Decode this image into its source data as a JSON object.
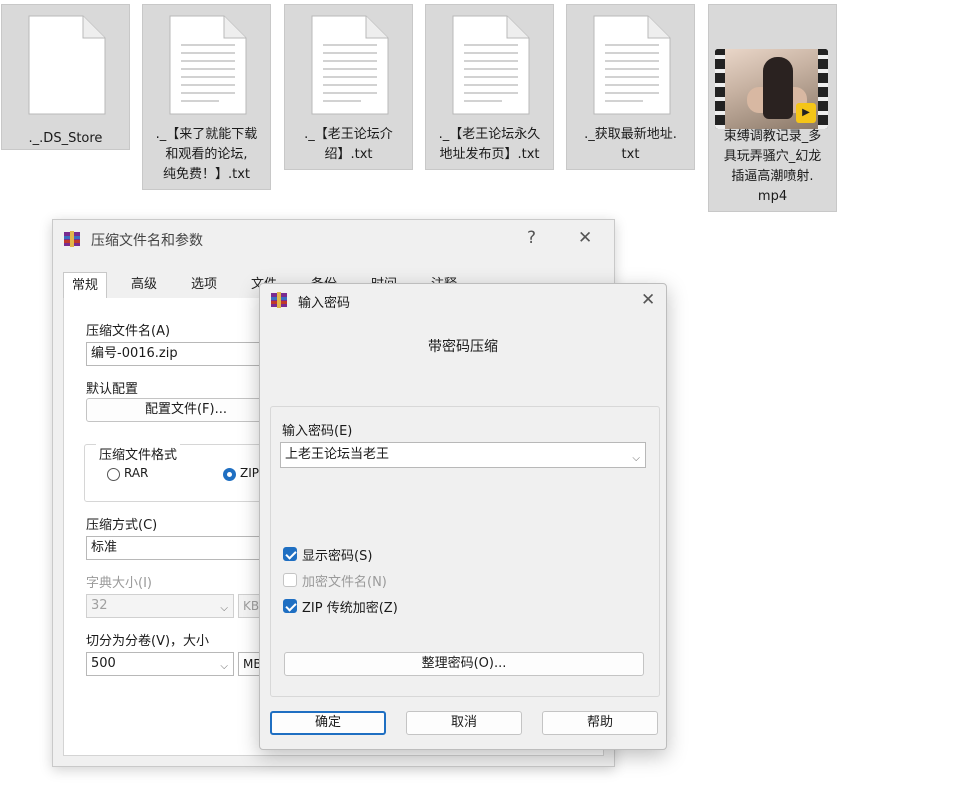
{
  "files": [
    {
      "label": "._.DS_Store",
      "type": "file"
    },
    {
      "label": "._【来了就能下载\n和观看的论坛,\n纯免费！】.txt",
      "type": "file"
    },
    {
      "label": "._【老王论坛介\n绍】.txt",
      "type": "file"
    },
    {
      "label": "._【老王论坛永久\n地址发布页】.txt",
      "type": "file"
    },
    {
      "label": "._获取最新地址.\ntxt",
      "type": "file"
    },
    {
      "label": "束缚调教记录_多\n具玩弄骚穴_幻龙\n插逼高潮喷射.\nmp4",
      "type": "video",
      "badge": "Player"
    }
  ],
  "back_dialog": {
    "title": "压缩文件名和参数",
    "help_icon": "?",
    "close_icon": "✕",
    "tabs": [
      "常规",
      "高级",
      "选项",
      "文件",
      "备份",
      "时间",
      "注释"
    ],
    "archive_name_label": "压缩文件名(A)",
    "archive_name_value": "编号-0016.zip",
    "default_profile_label": "默认配置",
    "profiles_button": "配置文件(F)...",
    "format_group_label": "压缩文件格式",
    "format_rar": "RAR",
    "format_zip": "ZIP",
    "method_label": "压缩方式(C)",
    "method_value": "标准",
    "dict_label": "字典大小(I)",
    "dict_value": "32",
    "dict_unit": "KB",
    "split_label": "切分为分卷(V)，大小",
    "split_value": "500",
    "split_unit": "MB"
  },
  "password_dialog": {
    "title": "输入密码",
    "close_icon": "✕",
    "heading": "带密码压缩",
    "password_label": "输入密码(E)",
    "password_value": "上老王论坛当老王",
    "show_password_label": "显示密码(S)",
    "show_password_checked": true,
    "encrypt_names_label": "加密文件名(N)",
    "encrypt_names_checked": false,
    "zip_legacy_label": "ZIP 传统加密(Z)",
    "zip_legacy_checked": true,
    "organize_button": "整理密码(O)...",
    "ok_button": "确定",
    "cancel_button": "取消",
    "help_button": "帮助"
  },
  "colors": {
    "accent": "#1f6fc2",
    "tile_bg": "#d9d9d9",
    "dialog_bg": "#f0f0f0"
  }
}
